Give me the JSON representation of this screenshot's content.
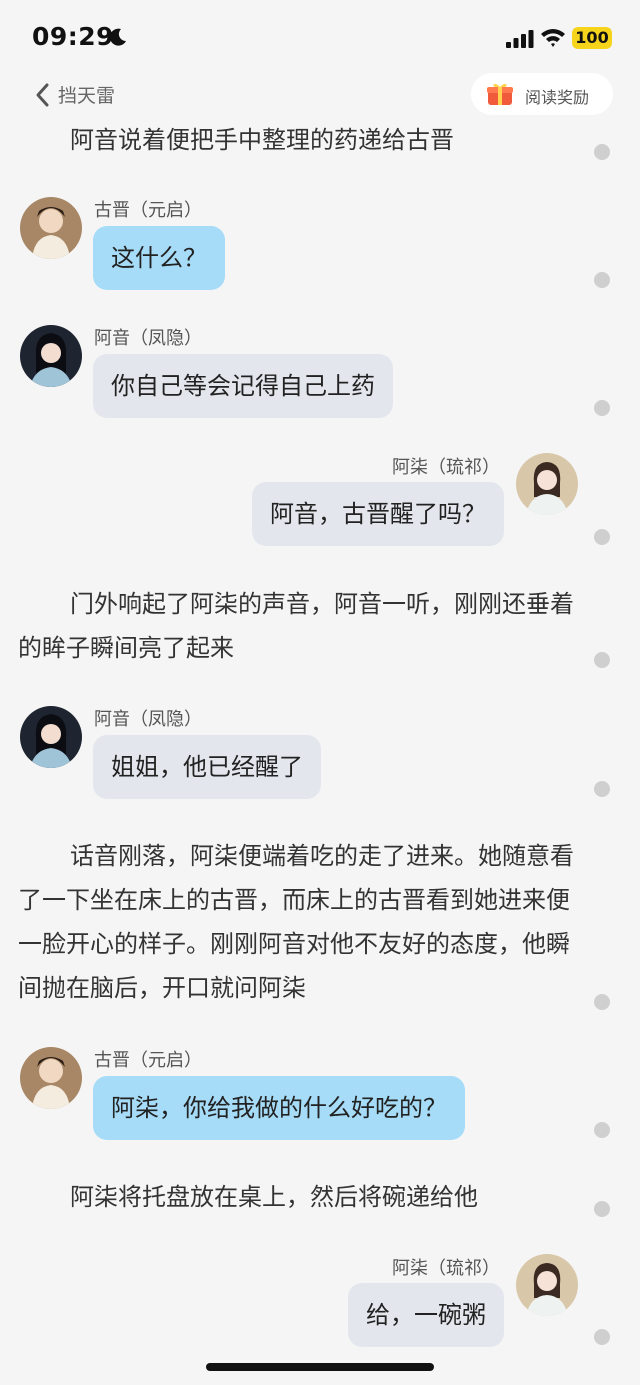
{
  "status_bar": {
    "time": "09:29",
    "battery": "100"
  },
  "nav": {
    "book_title": "挡天雷",
    "reward_label": "阅读奖励"
  },
  "story": {
    "narration_1": "阿音说着便把手中整理的药递给古晋",
    "speaker_1": "古晋（元启）",
    "message_1": "这什么？",
    "speaker_2": "阿音（凤隐）",
    "message_2": "你自己等会记得自己上药",
    "speaker_3": "阿柒（琉祁）",
    "message_3": "阿音，古晋醒了吗？",
    "narration_2": "门外响起了阿柒的声音，阿音一听，刚刚还垂着的眸子瞬间亮了起来",
    "speaker_4": "阿音（凤隐）",
    "message_4": "姐姐，他已经醒了",
    "narration_3": "话音刚落，阿柒便端着吃的走了进来。她随意看了一下坐在床上的古晋，而床上的古晋看到她进来便一脸开心的样子。刚刚阿音对他不友好的态度，他瞬间抛在脑后，开口就问阿柒",
    "speaker_5": "古晋（元启）",
    "message_5": "阿柒，你给我做的什么好吃的？",
    "narration_4": "阿柒将托盘放在桌上，然后将碗递给他",
    "speaker_6": "阿柒（琉祁）",
    "message_6": "给，一碗粥"
  },
  "colors": {
    "bubble_blue": "#a6dcf7",
    "bubble_gray": "#e3e7ed",
    "background": "#f5f5f5",
    "battery": "#f7d41c"
  }
}
